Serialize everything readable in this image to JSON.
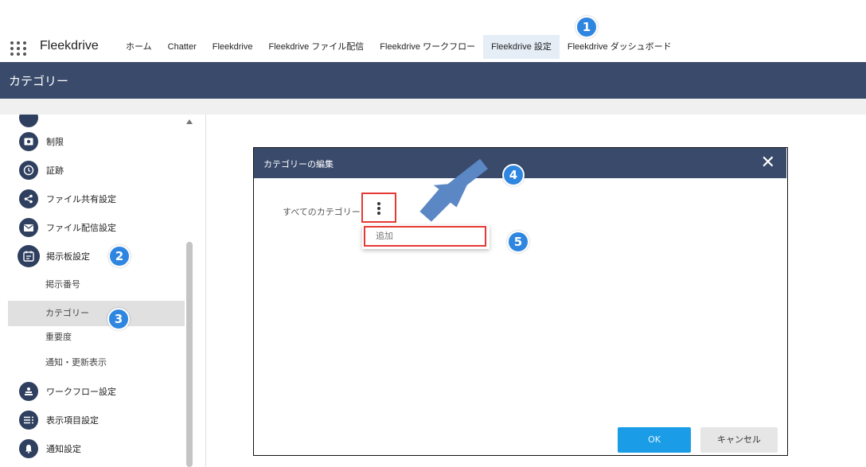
{
  "app": {
    "name": "Fleekdrive"
  },
  "nav": {
    "tabs": [
      {
        "label": "ホーム"
      },
      {
        "label": "Chatter"
      },
      {
        "label": "Fleekdrive"
      },
      {
        "label": "Fleekdrive ファイル配信"
      },
      {
        "label": "Fleekdrive ワークフロー"
      },
      {
        "label": "Fleekdrive 設定",
        "active": true
      },
      {
        "label": "Fleekdrive ダッシュボード"
      }
    ]
  },
  "header": {
    "title": "カテゴリー"
  },
  "sidebar": {
    "items": [
      {
        "label": "制限",
        "icon": "restriction-icon"
      },
      {
        "label": "証跡",
        "icon": "clock-icon"
      },
      {
        "label": "ファイル共有設定",
        "icon": "share-icon"
      },
      {
        "label": "ファイル配信設定",
        "icon": "mail-icon"
      },
      {
        "label": "掲示板設定",
        "icon": "bulletin-icon"
      }
    ],
    "subitems": [
      {
        "label": "掲示番号"
      },
      {
        "label": "カテゴリー",
        "selected": true
      },
      {
        "label": "重要度"
      },
      {
        "label": "通知・更新表示"
      }
    ],
    "items_after": [
      {
        "label": "ワークフロー設定",
        "icon": "workflow-icon"
      },
      {
        "label": "表示項目設定",
        "icon": "list-icon"
      },
      {
        "label": "通知設定",
        "icon": "bell-icon"
      }
    ]
  },
  "modal": {
    "title": "カテゴリーの編集",
    "close_symbol": "✕",
    "tree_root_label": "すべてのカテゴリー",
    "menu": {
      "add_label": "追加"
    },
    "ok_label": "OK",
    "cancel_label": "キャンセル"
  },
  "annotations": {
    "badges": [
      "1",
      "2",
      "3",
      "4",
      "5"
    ]
  },
  "colors": {
    "header_bg": "#3a4a6b",
    "badge": "#2e86e0",
    "highlight_red": "#e53935",
    "ok_button": "#1a9de6",
    "active_tab_bg": "#e5edf6"
  }
}
